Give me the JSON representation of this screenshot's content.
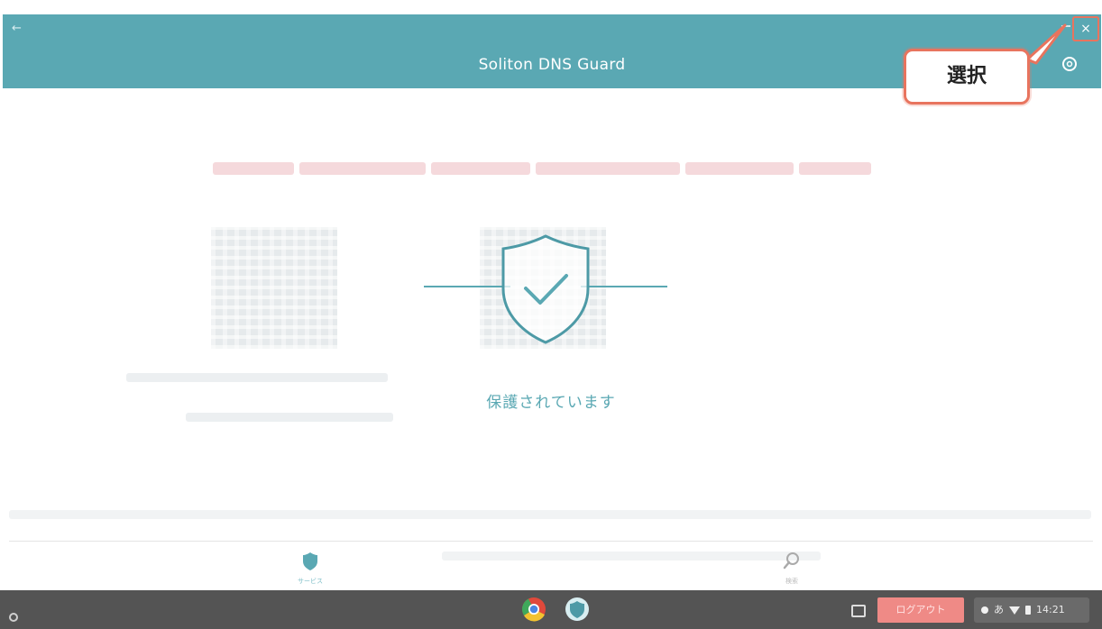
{
  "window": {
    "title": "Soliton DNS Guard",
    "close_glyph": "×",
    "back_glyph": "←"
  },
  "callout": {
    "label": "選択"
  },
  "status": {
    "message": "保護されています"
  },
  "bottom_nav": {
    "items": [
      {
        "label": "サービス",
        "icon": "shield-icon"
      },
      {
        "label": "検索",
        "icon": "search-icon"
      }
    ]
  },
  "shelf": {
    "logout_label": "ログアウト",
    "time": "14:21",
    "ime": "あ"
  },
  "colors": {
    "accent": "#5aa8b3",
    "callout_border": "#e8745e",
    "shelf": "#545454",
    "logout": "#ef8a86"
  }
}
